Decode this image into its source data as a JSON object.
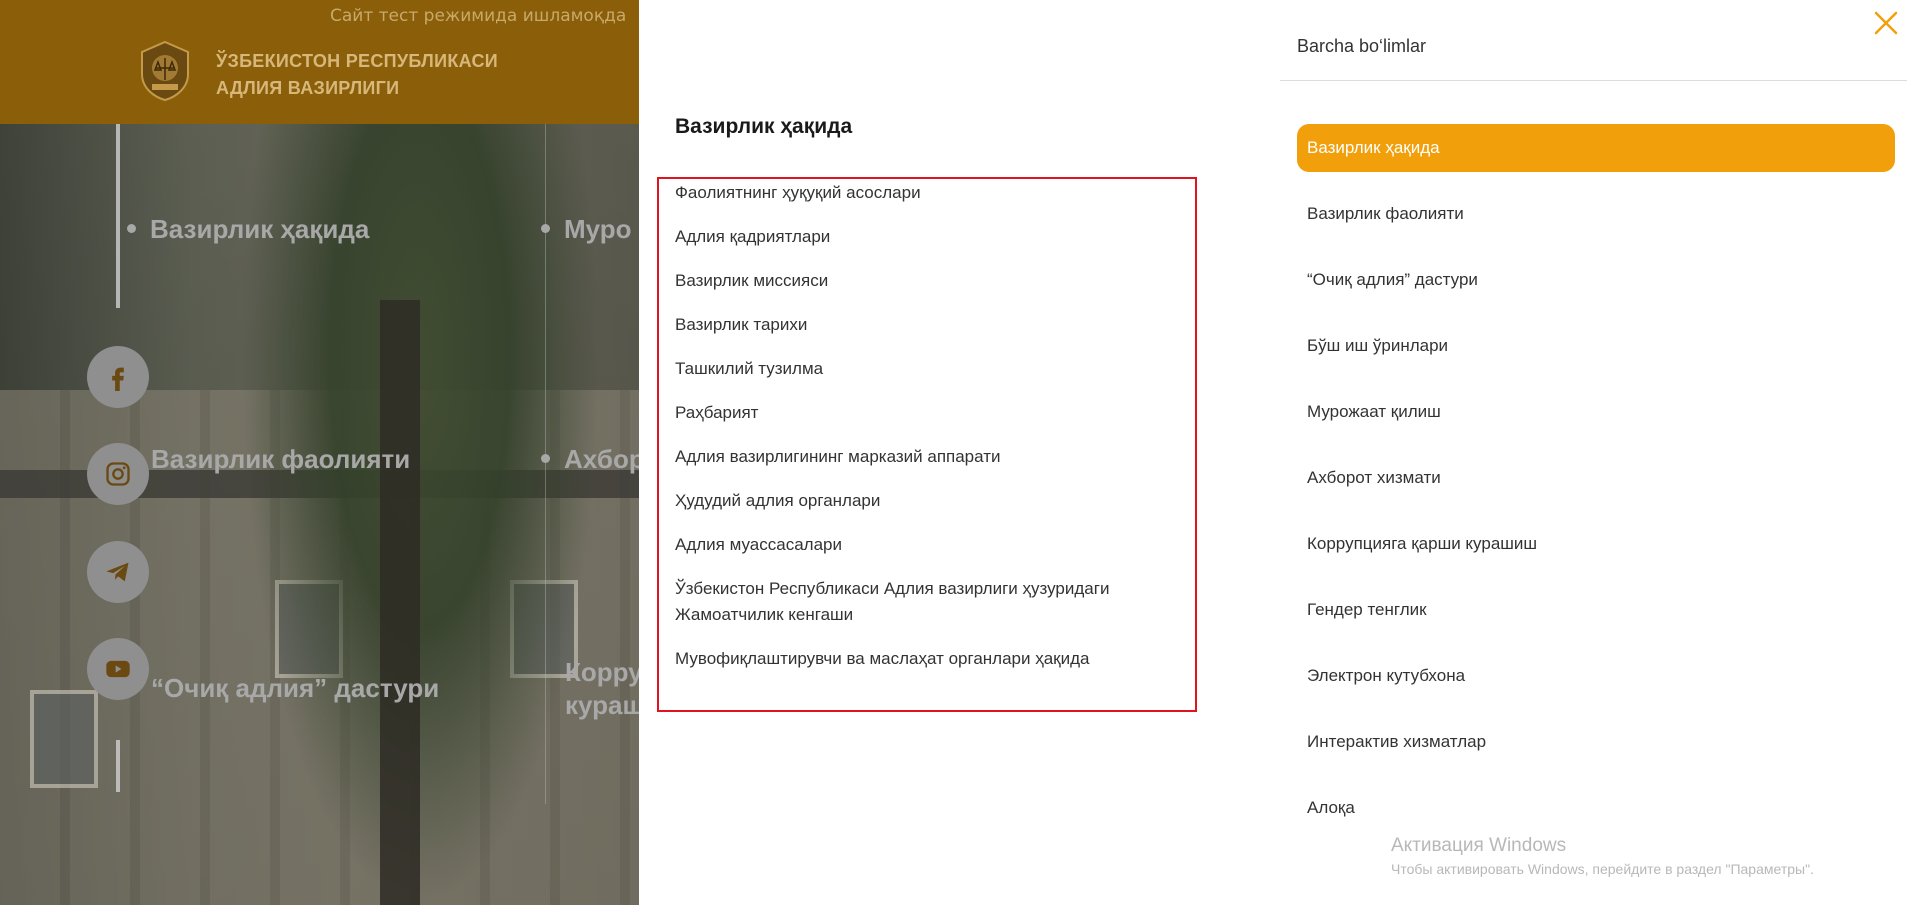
{
  "header": {
    "test_banner": "Сайт тест режимида ишламоқда",
    "org_line1": "ЎЗБЕКИСТОН РЕСПУБЛИКАСИ",
    "org_line2": "АДЛИЯ ВАЗИРЛИГИ"
  },
  "background_menu": {
    "col1": [
      "Вазирлик ҳақида",
      "Вазирлик фаолияти",
      "“Очиқ адлия” дастури"
    ],
    "col2": [
      "Муро",
      "Ахбор",
      "Корру",
      "кураш"
    ]
  },
  "social_icons": [
    "facebook-icon",
    "instagram-icon",
    "telegram-icon",
    "youtube-icon"
  ],
  "submenu": {
    "title": "Вазирлик ҳақида",
    "links": [
      "Фаолиятнинг ҳуқуқий асослари",
      "Адлия қадриятлари",
      "Вазирлик миссияси",
      "Вазирлик тарихи",
      "Ташкилий тузилма",
      "Раҳбарият",
      "Адлия вазирлигининг марказий аппарати",
      "Ҳудудий адлия органлари",
      "Адлия муассасалари",
      "Ўзбекистон Республикаси Адлия вазирлиги ҳузуридаги Жамоатчилик кенгаши",
      "Мувофиқлаштирувчи ва маслаҳат органлари ҳақида"
    ]
  },
  "sections": {
    "title": "Barcha bo‘limlar",
    "items": [
      "Вазирлик ҳақида",
      "Вазирлик фаолияти",
      "“Очиқ адлия” дастури",
      "Бўш иш ўринлари",
      "Мурожаат қилиш",
      "Ахборот хизмати",
      "Коррупцияга қарши курашиш",
      "Гендер тенглик",
      "Электрон кутубхона",
      "Интерактив хизматлар",
      "Алоқа"
    ],
    "active_index": 0
  },
  "watermark": {
    "line1": "Активация Windows",
    "line2": "Чтобы активировать Windows, перейдите в раздел \"Параметры\"."
  },
  "colors": {
    "header": "#8b5e0a",
    "accent": "#f29f0c",
    "highlight_border": "#e0141e"
  }
}
